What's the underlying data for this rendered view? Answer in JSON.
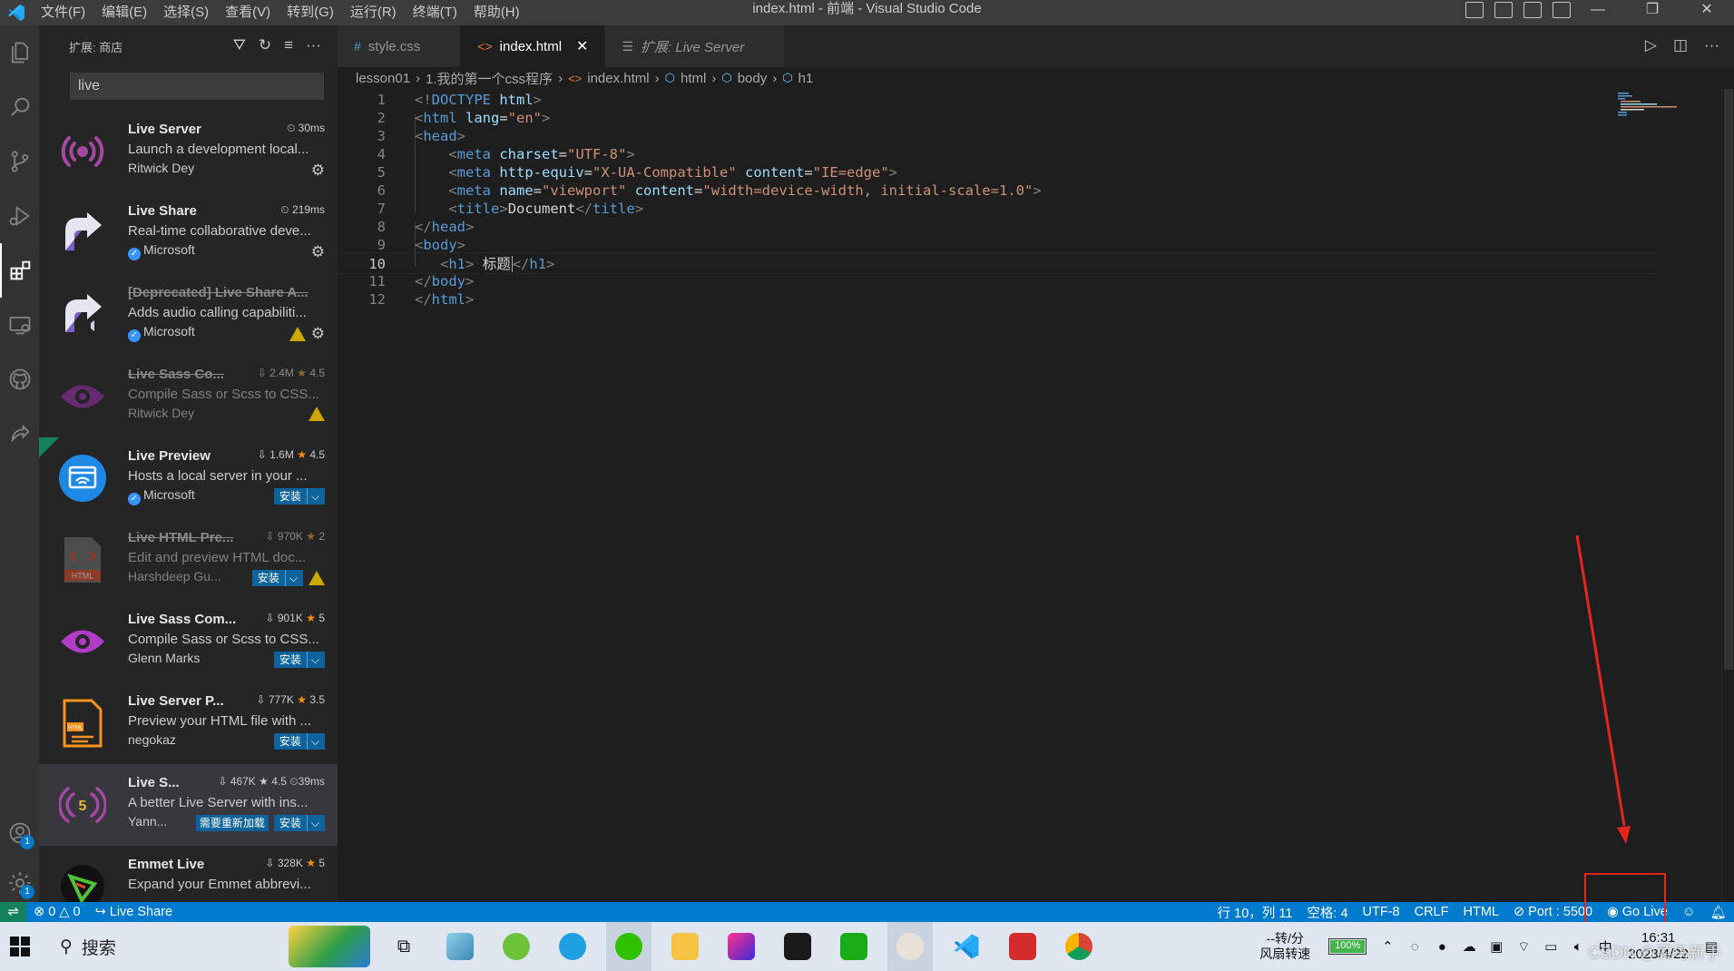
{
  "window": {
    "title": "index.html - 前端 - Visual Studio Code",
    "menu": [
      "文件(F)",
      "编辑(E)",
      "选择(S)",
      "查看(V)",
      "转到(G)",
      "运行(R)",
      "终端(T)",
      "帮助(H)"
    ]
  },
  "activity_bar": {
    "items": [
      "explorer-icon",
      "search-icon",
      "source-control-icon",
      "run-debug-icon",
      "extensions-icon",
      "remote-explorer-icon",
      "github-icon",
      "live-share-icon"
    ],
    "accounts_badge": "1",
    "settings_badge": "1"
  },
  "sidebar": {
    "title": "扩展: 商店",
    "search_value": "live",
    "extensions": [
      {
        "name": "Live Server",
        "time": "30ms",
        "desc": "Launch a development local...",
        "publisher": "Ritwick Dey"
      },
      {
        "name": "Live Share",
        "time": "219ms",
        "desc": "Real-time collaborative deve...",
        "publisher": "Microsoft"
      },
      {
        "name": "[Deprecated] Live Share A...",
        "desc": "Adds audio calling capabiliti...",
        "publisher": "Microsoft"
      },
      {
        "name": "Live Sass Co...",
        "downloads": "2.4M",
        "rating": "4.5",
        "desc": "Compile Sass or Scss to CSS...",
        "publisher": "Ritwick Dey"
      },
      {
        "name": "Live Preview",
        "downloads": "1.6M",
        "rating": "4.5",
        "desc": "Hosts a local server in your ...",
        "publisher": "Microsoft",
        "install": "安装"
      },
      {
        "name": "Live HTML Pre...",
        "downloads": "970K",
        "rating": "2",
        "desc": "Edit and preview HTML doc...",
        "publisher": "Harshdeep Gu...",
        "install": "安装"
      },
      {
        "name": "Live Sass Com...",
        "downloads": "901K",
        "rating": "5",
        "desc": "Compile Sass or Scss to CSS...",
        "publisher": "Glenn Marks",
        "install": "安装"
      },
      {
        "name": "Live Server P...",
        "downloads": "777K",
        "rating": "3.5",
        "desc": "Preview your HTML file with ...",
        "publisher": "negokaz",
        "install": "安装"
      },
      {
        "name": "Live S...",
        "downloads": "467K",
        "rating": "4.5",
        "time": "39ms",
        "desc": "A better Live Server with ins...",
        "publisher": "Yann...",
        "reload": "需要重新加载",
        "install": "安装"
      },
      {
        "name": "Emmet Live",
        "downloads": "328K",
        "rating": "5",
        "desc": "Expand your Emmet abbrevi..."
      }
    ]
  },
  "tabs": [
    {
      "label": "style.css"
    },
    {
      "label": "index.html"
    },
    {
      "label": "扩展: Live Server"
    }
  ],
  "breadcrumb": [
    "lesson01",
    "1.我的第一个css程序",
    "index.html",
    "html",
    "body",
    "h1"
  ],
  "editor": {
    "line_numbers": [
      "1",
      "2",
      "3",
      "4",
      "5",
      "6",
      "7",
      "8",
      "9",
      "10",
      "11",
      "12"
    ],
    "current_line": 10
  },
  "statusbar": {
    "errors": "0",
    "warnings": "0",
    "live_share": "Live Share",
    "position": "行 10，列 11",
    "spaces": "空格: 4",
    "encoding": "UTF-8",
    "eol": "CRLF",
    "language": "HTML",
    "port": "Port : 5500",
    "go_live": "Go Live"
  },
  "taskbar": {
    "search": "搜索",
    "net_speed": "--转/分",
    "net_label": "风扇转速",
    "battery": "100%",
    "ime": "中",
    "time": "16:31",
    "date": "2023/4/22",
    "watermark": "CSDN @菜鸟新手"
  },
  "colors": {
    "accent": "#007acc",
    "annotation": "#e5251e"
  }
}
